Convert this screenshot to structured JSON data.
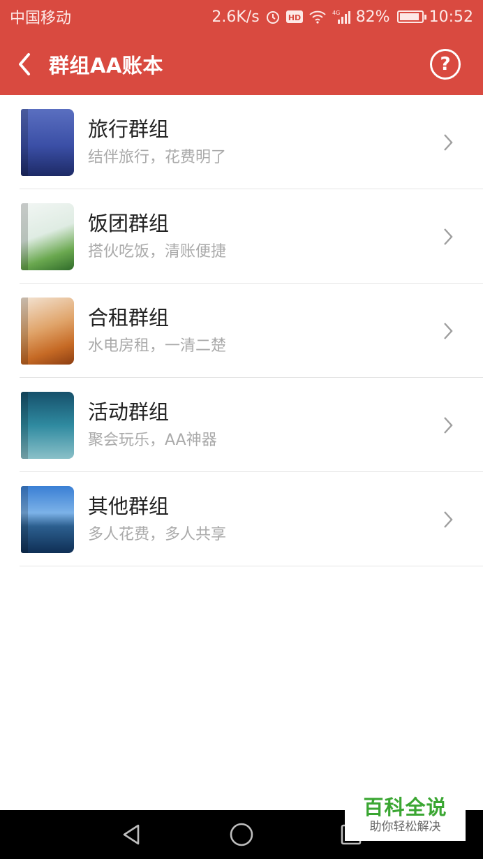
{
  "status_bar": {
    "carrier": "中国移动",
    "speed": "2.6K/s",
    "network": "4G",
    "battery": "82%",
    "time": "10:52",
    "icons": [
      "alarm-icon",
      "hd-icon",
      "wifi-icon",
      "signal-icon",
      "battery-icon"
    ]
  },
  "app_bar": {
    "title": "群组AA账本",
    "back_icon": "chevron-left-icon",
    "help_label": "?"
  },
  "groups": [
    {
      "title": "旅行群组",
      "subtitle": "结伴旅行，花费明了"
    },
    {
      "title": "饭团群组",
      "subtitle": "搭伙吃饭，清账便捷"
    },
    {
      "title": "合租群组",
      "subtitle": "水电房租，一清二楚"
    },
    {
      "title": "活动群组",
      "subtitle": "聚会玩乐，AA神器"
    },
    {
      "title": "其他群组",
      "subtitle": "多人花费，多人共享"
    }
  ],
  "nav_bar": {
    "buttons": [
      "back-triangle-icon",
      "home-circle-icon",
      "recents-square-icon"
    ]
  },
  "watermark": {
    "title": "百科全说",
    "subtitle": "助你轻松解决"
  },
  "colors": {
    "accent": "#d94a40",
    "title_text": "#222222",
    "subtitle_text": "#aaaaaa"
  }
}
